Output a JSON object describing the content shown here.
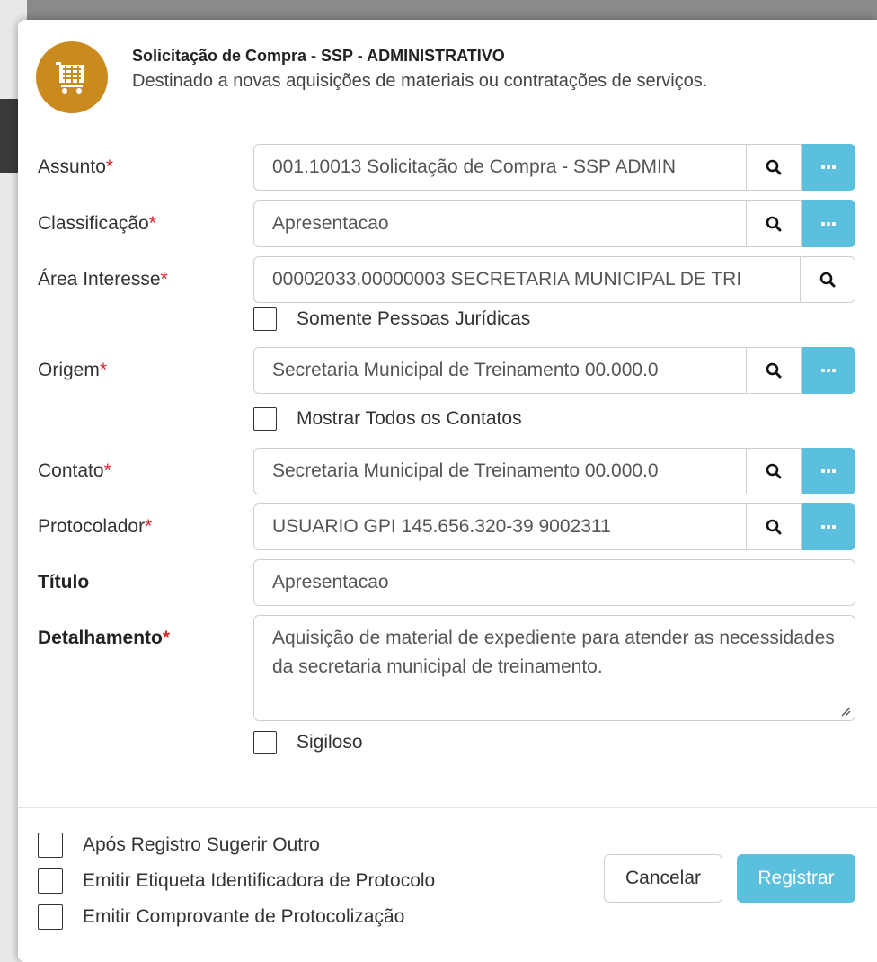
{
  "header": {
    "title": "Solicitação de Compra - SSP - ADMINISTRATIVO",
    "description": "Destinado a novas aquisições de materiais ou contratações de serviços.",
    "icon": "shopping-cart-icon",
    "icon_color": "#c98a1e"
  },
  "required_marker": "*",
  "fields": {
    "assunto": {
      "label": "Assunto",
      "value": "001.10013 Solicitação de Compra - SSP ADMIN"
    },
    "classificacao": {
      "label": "Classificação",
      "value": "Apresentacao"
    },
    "area_interesse": {
      "label": "Área Interesse",
      "value": "00002033.00000003 SECRETARIA MUNICIPAL DE TRI"
    },
    "origem": {
      "label": "Origem",
      "value": "Secretaria Municipal de Treinamento  00.000.0"
    },
    "contato": {
      "label": "Contato",
      "value": "Secretaria Municipal de Treinamento  00.000.0"
    },
    "protocolador": {
      "label": "Protocolador",
      "value": "USUARIO GPI 145.656.320-39 9002311"
    },
    "titulo": {
      "label": "Título",
      "value": "Apresentacao"
    },
    "detalhamento": {
      "label": "Detalhamento",
      "value": "Aquisição de material de expediente para atender as necessidades da secretaria municipal de treinamento."
    }
  },
  "checkboxes": {
    "somente_pj": "Somente Pessoas Jurídicas",
    "mostrar_contatos": "Mostrar Todos os Contatos",
    "sigiloso": "Sigiloso",
    "sugerir_outro": "Após Registro Sugerir Outro",
    "emitir_etiqueta": "Emitir Etiqueta Identificadora de Protocolo",
    "emitir_comprovante": "Emitir Comprovante de Protocolização"
  },
  "buttons": {
    "cancel": "Cancelar",
    "register": "Registrar"
  },
  "colors": {
    "accent": "#5bc0de",
    "required": "#d9262b"
  }
}
